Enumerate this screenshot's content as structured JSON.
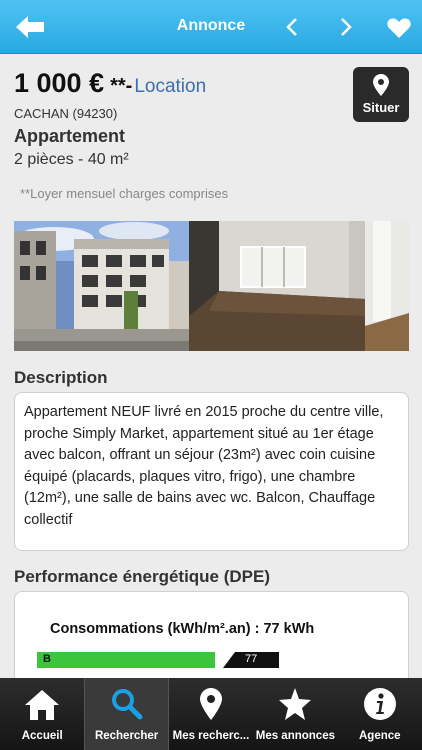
{
  "header": {
    "title": "Annonce"
  },
  "listing": {
    "price": "1 000 €",
    "price_suffix": "**-",
    "transaction": "Location",
    "city": "CACHAN (94230)",
    "property_type": "Appartement",
    "rooms_area": "2 pièces - 40 m²",
    "note": "**Loyer mensuel charges comprises",
    "locate_label": "Situer"
  },
  "description": {
    "title": "Description",
    "text": "Appartement NEUF livré en 2015 proche du centre ville, proche Simply Market, appartement situé au 1er étage avec balcon, offrant un séjour (23m²) avec coin cuisine équipé (placards, plaques vitro, frigo), une chambre (12m²), une salle de bains avec wc. Balcon, Chauffage collectif"
  },
  "dpe": {
    "title": "Performance énergétique (DPE)",
    "consumption_label": "Consommations (kWh/m².an) : 77 kWh",
    "class_letter": "B",
    "value": "77",
    "bar_color": "#3cc43c"
  },
  "tabs": [
    {
      "label": "Accueil",
      "icon": "home-icon"
    },
    {
      "label": "Rechercher",
      "icon": "search-icon",
      "active": true
    },
    {
      "label": "Mes recherc...",
      "icon": "map-pin-icon"
    },
    {
      "label": "Mes annonces",
      "icon": "star-icon"
    },
    {
      "label": "Agence",
      "icon": "info-icon"
    }
  ],
  "colors": {
    "header": "#28a8e2",
    "accent": "#3a6fb0",
    "tabbar": "#1e1e1e"
  }
}
